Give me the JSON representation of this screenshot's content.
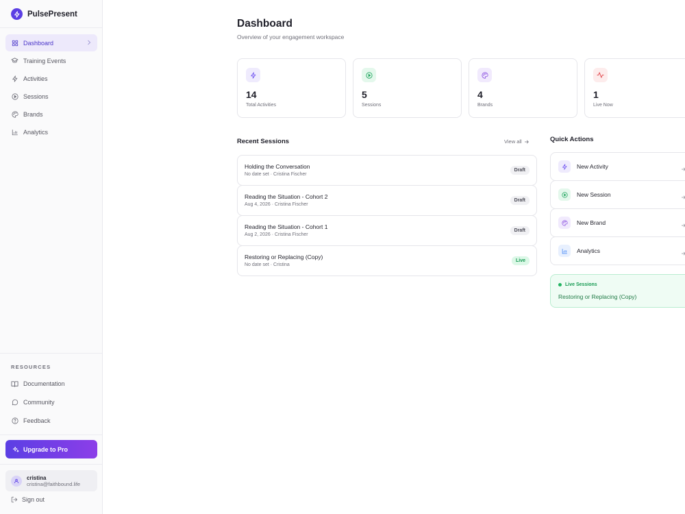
{
  "app": {
    "name": "PulsePresent"
  },
  "sidebar": {
    "nav": [
      {
        "label": "Dashboard",
        "icon": "grid-icon",
        "active": true
      },
      {
        "label": "Training Events",
        "icon": "graduation-cap-icon"
      },
      {
        "label": "Activities",
        "icon": "bolt-icon"
      },
      {
        "label": "Sessions",
        "icon": "play-circle-icon"
      },
      {
        "label": "Brands",
        "icon": "palette-icon"
      },
      {
        "label": "Analytics",
        "icon": "bar-chart-icon"
      }
    ],
    "resources_title": "RESOURCES",
    "resources": [
      {
        "label": "Documentation",
        "icon": "book-icon"
      },
      {
        "label": "Community",
        "icon": "chat-bubble-icon"
      },
      {
        "label": "Feedback",
        "icon": "question-circle-icon"
      }
    ],
    "upgrade_label": "Upgrade to Pro",
    "user": {
      "name": "cristina",
      "email": "cristina@faithbound.life"
    },
    "signout_label": "Sign out"
  },
  "main": {
    "title": "Dashboard",
    "subtitle": "Overview of your engagement workspace",
    "stats": [
      {
        "value": "14",
        "label": "Total Activities",
        "icon": "bolt-icon",
        "color": "#6b4ef0",
        "bg": "#efebfd"
      },
      {
        "value": "5",
        "label": "Sessions",
        "icon": "play-circle-icon",
        "color": "#1aa35a",
        "bg": "#e4f8ec"
      },
      {
        "value": "4",
        "label": "Brands",
        "icon": "palette-icon",
        "color": "#8a4fe0",
        "bg": "#f1eafd"
      },
      {
        "value": "1",
        "label": "Live Now",
        "icon": "activity-icon",
        "color": "#e0464a",
        "bg": "#fdecec"
      }
    ],
    "recent_sessions_title": "Recent Sessions",
    "view_all_label": "View all",
    "sessions": [
      {
        "title": "Holding the Conversation",
        "meta": "No date set · Cristina Fischer",
        "status": "Draft"
      },
      {
        "title": "Reading the Situation - Cohort 2",
        "meta": "Aug 4, 2026 · Cristina Fischer",
        "status": "Draft"
      },
      {
        "title": "Reading the Situation - Cohort 1",
        "meta": "Aug 2, 2026 · Cristina Fischer",
        "status": "Draft"
      },
      {
        "title": "Restoring or Replacing (Copy)",
        "meta": "No date set · Cristina",
        "status": "Live"
      }
    ],
    "quick_actions_title": "Quick Actions",
    "quick_actions": [
      {
        "label": "New Activity",
        "icon": "bolt-icon",
        "color": "#6b4ef0",
        "bg": "#efebfd"
      },
      {
        "label": "New Session",
        "icon": "play-circle-icon",
        "color": "#1aa35a",
        "bg": "#e4f8ec"
      },
      {
        "label": "New Brand",
        "icon": "palette-icon",
        "color": "#8a4fe0",
        "bg": "#f1eafd"
      },
      {
        "label": "Analytics",
        "icon": "bar-chart-icon",
        "color": "#3b82f6",
        "bg": "#e8f0fe"
      }
    ],
    "live_sessions": {
      "title": "Live Sessions",
      "session": "Restoring or Replacing (Copy)"
    }
  }
}
